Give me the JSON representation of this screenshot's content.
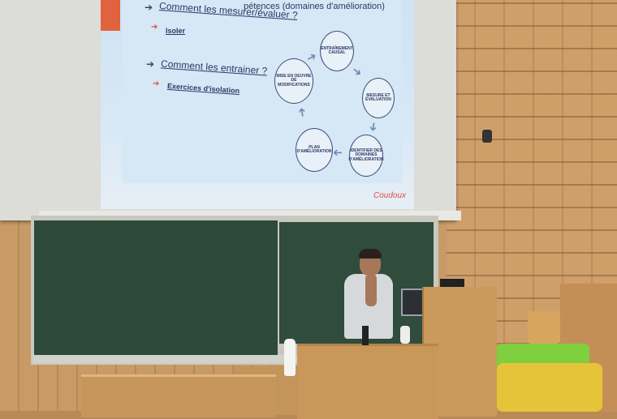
{
  "slide": {
    "top_line": "pétences (domaines d'amélioration)",
    "q1": "Comment les mesurer/évaluer ?",
    "q1_sub": "Isoler",
    "q2": "Comment les entrainer ?",
    "q2_sub": "Exercices d'isolation",
    "cycle": {
      "c1": "ENTRAÎNEMENT CAUSAL",
      "c2": "MESURE ET ÉVALUATION",
      "c3": "IDENTIFIER DES DOMAINES D'AMÉLIORATION",
      "c4": "PLAN D'AMÉLIORATION",
      "c5": "MISE EN OEUVRE DE MODIFICATIONS"
    },
    "logo": "Coudoux"
  }
}
